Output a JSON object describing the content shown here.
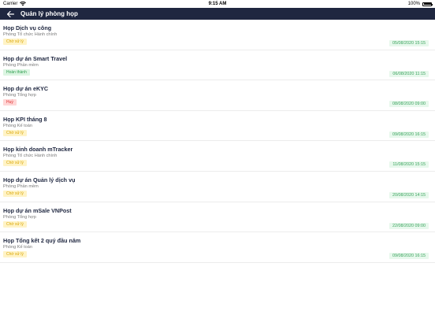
{
  "statusbar": {
    "carrier": "Carrier",
    "time": "9:15 AM",
    "battery": "100%"
  },
  "navbar": {
    "back_icon": "arrow-left-icon",
    "title": "Quản lý phòng họp"
  },
  "meetings": [
    {
      "name": "Họp Dịch vụ công",
      "dept": "Phòng Tổ chức Hành chính",
      "status": "Chờ xử lý",
      "status_type": "pending",
      "date": "05/08/2020 15:15"
    },
    {
      "name": "Họp dự án Smart Travel",
      "dept": "Phòng Phần mềm",
      "status": "Hoàn thành",
      "status_type": "done",
      "date": "06/08/2020 11:15"
    },
    {
      "name": "Họp dự án eKYC",
      "dept": "Phòng Tổng hợp",
      "status": "Huỷ",
      "status_type": "cancel",
      "date": "08/08/2020 09:00"
    },
    {
      "name": "Họp KPI tháng 8",
      "dept": "Phòng Kế toán",
      "status": "Chờ xử lý",
      "status_type": "pending",
      "date": "09/08/2020 16:15"
    },
    {
      "name": "Họp kinh doanh mTracker",
      "dept": "Phòng Tổ chức Hành chính",
      "status": "Chờ xử lý",
      "status_type": "pending",
      "date": "11/08/2020 15:15"
    },
    {
      "name": "Họp dự án Quản lý dịch vụ",
      "dept": "Phòng Phần mềm",
      "status": "Chờ xử lý",
      "status_type": "pending",
      "date": "20/08/2020 14:15"
    },
    {
      "name": "Họp dự án mSale VNPost",
      "dept": "Phòng Tổng hợp",
      "status": "Chờ xử lý",
      "status_type": "pending",
      "date": "22/08/2020 09:00"
    },
    {
      "name": "Họp Tổng kết 2 quý đầu năm",
      "dept": "Phòng Kế toán",
      "status": "Chờ xử lý",
      "status_type": "pending",
      "date": "09/08/2020 16:15"
    }
  ],
  "colors": {
    "navbar_bg": "#1f2740",
    "pending_bg": "#fff3c6",
    "pending_fg": "#d9a400",
    "done_bg": "#dcf5e2",
    "done_fg": "#2e9e4f",
    "cancel_bg": "#ffd6d6",
    "cancel_fg": "#e02d2d",
    "date_bg": "#e7f8ec",
    "date_fg": "#3aa35d"
  }
}
